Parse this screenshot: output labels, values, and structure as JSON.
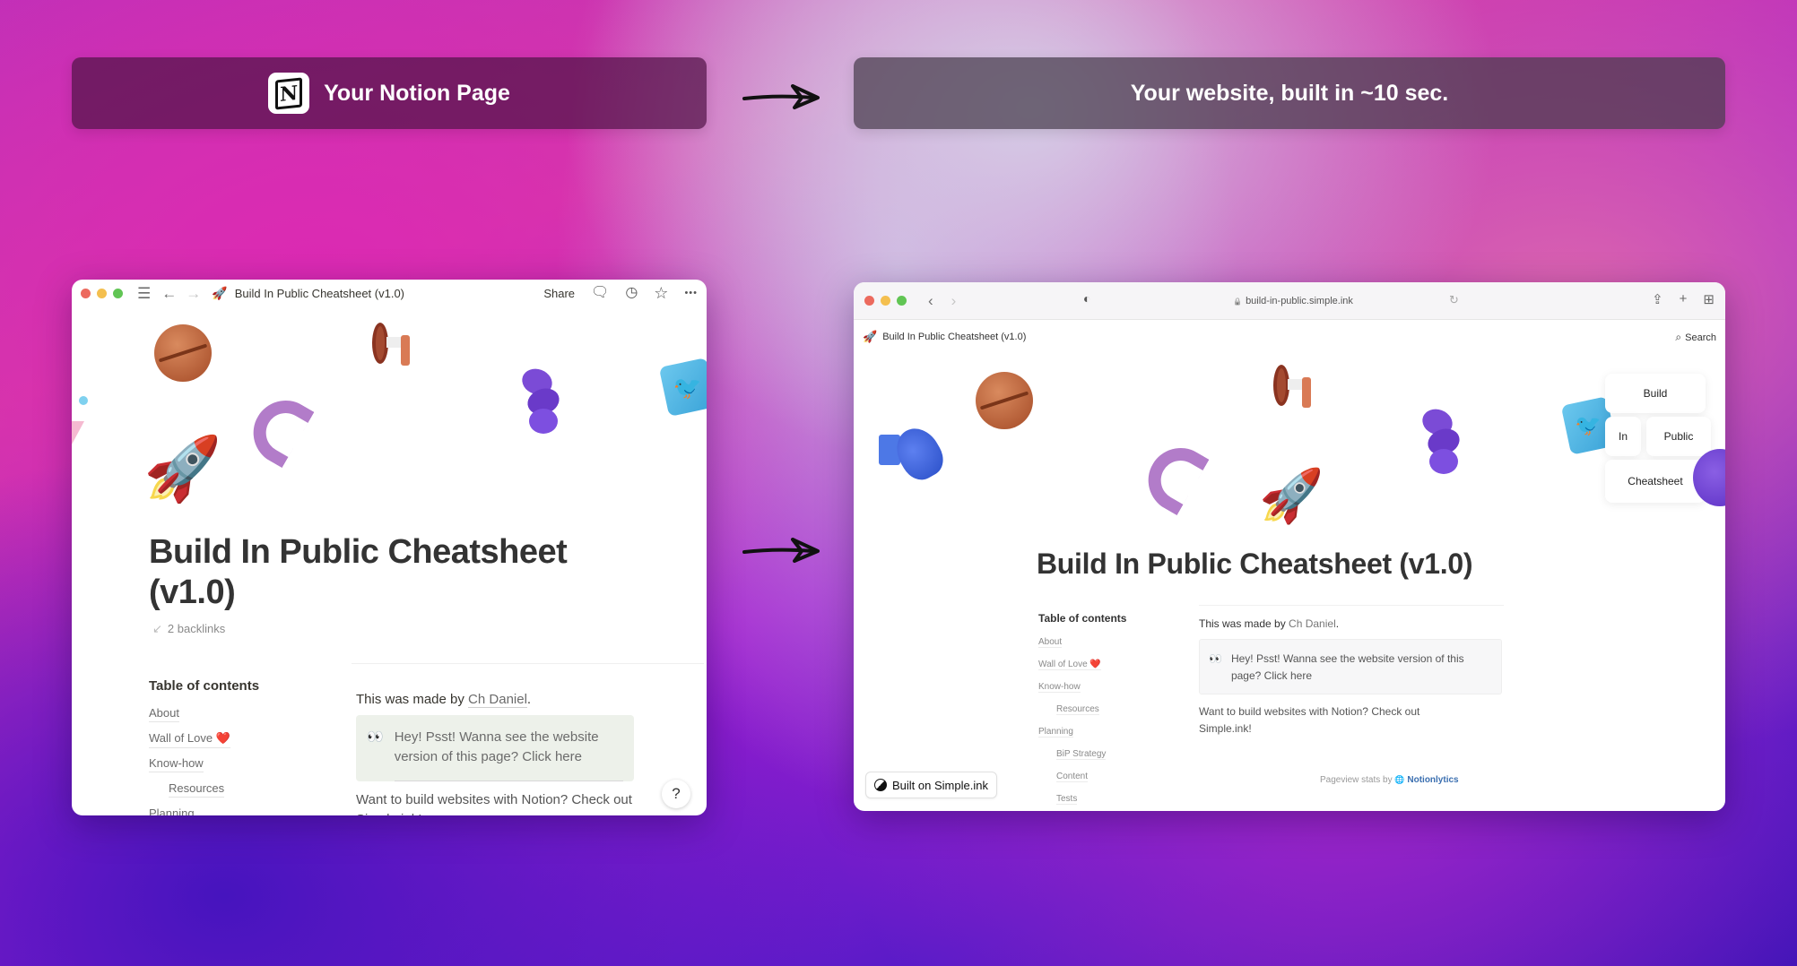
{
  "banners": {
    "left_label": "Your Notion Page",
    "left_icon": "notion-logo-icon",
    "notion_glyph": "N",
    "right_label": "Your website, built in ~10 sec."
  },
  "arrows": [
    "right-arrow-icon",
    "right-arrow-icon"
  ],
  "notion_window": {
    "titlebar": {
      "menu_icon": "☰",
      "back_icon": "←",
      "forward_icon": "→",
      "page_emoji": "🚀",
      "page_title": "Build In Public Cheatsheet (v1.0)",
      "share_label": "Share",
      "comment_icon": "🗨",
      "history_icon": "◷",
      "favorite_icon": "☆",
      "more_icon": "•••"
    },
    "decorations": [
      "planet",
      "megaphone",
      "macaroni",
      "spiral",
      "twitter-cube",
      "rocket"
    ],
    "title": "Build In Public Cheatsheet (v1.0)",
    "backlinks": "2 backlinks",
    "backlinks_icon": "↙",
    "toc_title": "Table of contents",
    "toc": [
      {
        "label": "About",
        "indent": false
      },
      {
        "label": "Wall of Love ❤️",
        "indent": false
      },
      {
        "label": "Know-how",
        "indent": false
      },
      {
        "label": "Resources",
        "indent": true
      },
      {
        "label": "Planning",
        "indent": false
      }
    ],
    "made_by_prefix": "This was made by ",
    "made_by_link": "Ch Daniel",
    "made_by_suffix": ".",
    "callout_emoji": "👀",
    "callout_text": "Hey! Psst! Wanna see the website version of this page? Click here",
    "want_text": "Want to build websites with Notion? Check out Simple.ink!",
    "help_label": "?"
  },
  "browser_window": {
    "back_icon": "‹",
    "forward_icon": "›",
    "shield_icon": "◐",
    "lock_icon": "🔒",
    "url": "build-in-public.simple.ink",
    "reload_icon": "↻",
    "share_icon": "⇪",
    "new_tab_icon": "+",
    "tabs_icon": "⊞",
    "site_header": {
      "emoji": "🚀",
      "title": "Build In Public Cheatsheet (v1.0)",
      "search_label": "Search",
      "search_icon": "⌕"
    },
    "word_cards": [
      "Build",
      "In",
      "Public",
      "Cheatsheet"
    ],
    "title": "Build In Public Cheatsheet (v1.0)",
    "toc_title": "Table of contents",
    "toc": [
      {
        "label": "About",
        "indent": false
      },
      {
        "label": "Wall of Love ❤️",
        "indent": false
      },
      {
        "label": "Know-how",
        "indent": false
      },
      {
        "label": "Resources",
        "indent": true
      },
      {
        "label": "Planning",
        "indent": false
      },
      {
        "label": "BiP Strategy",
        "indent": true
      },
      {
        "label": "Content",
        "indent": true
      },
      {
        "label": "Tests",
        "indent": true
      }
    ],
    "made_by_prefix": "This was made by ",
    "made_by_link": "Ch Daniel",
    "made_by_suffix": ".",
    "callout_emoji": "👀",
    "callout_text": "Hey! Psst! Wanna see the website version of this page? Click here",
    "want_text": "Want to build websites with Notion? Check out Simple.ink!",
    "stats_prefix": "Pageview stats by ",
    "stats_icon": "🌐",
    "stats_link": "Notionlytics",
    "built_on_label": "Built on Simple.ink"
  }
}
